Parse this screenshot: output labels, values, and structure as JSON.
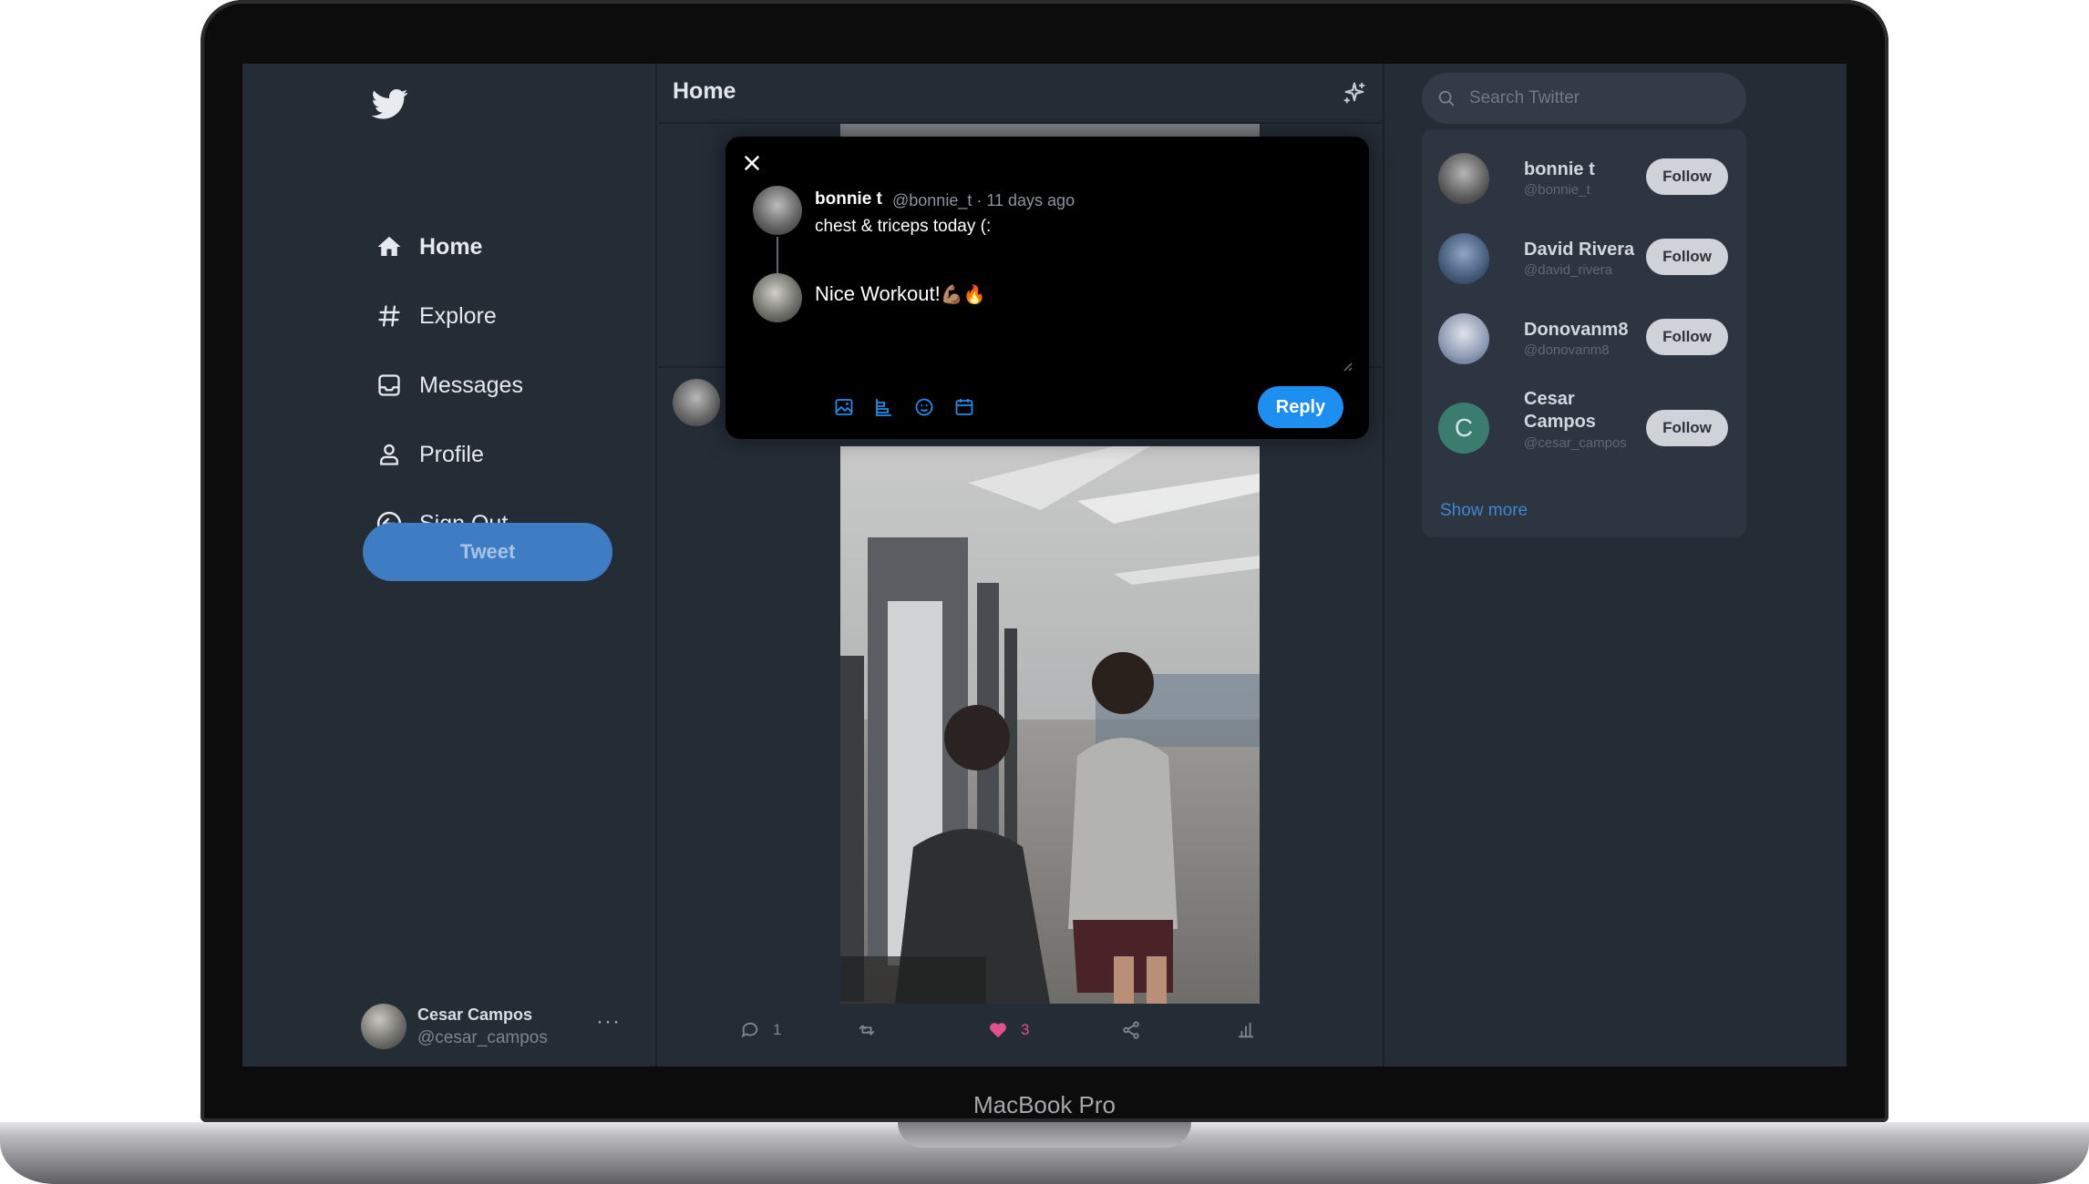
{
  "device": {
    "label": "MacBook Pro"
  },
  "sidebar": {
    "logo_icon": "twitter-bird-icon",
    "items": [
      {
        "label": "Home",
        "icon": "home-icon",
        "active": true
      },
      {
        "label": "Explore",
        "icon": "hashtag-icon",
        "active": false
      },
      {
        "label": "Messages",
        "icon": "inbox-icon",
        "active": false
      },
      {
        "label": "Profile",
        "icon": "user-icon",
        "active": false
      },
      {
        "label": "Sign Out",
        "icon": "sign-out-icon",
        "active": false
      }
    ],
    "tweet_label": "Tweet",
    "account": {
      "name": "Cesar Campos",
      "handle": "@cesar_campos",
      "more": "···"
    }
  },
  "feed": {
    "title": "Home",
    "post": {
      "actions": [
        {
          "name": "reply",
          "icon": "comment-icon",
          "count": "1"
        },
        {
          "name": "retweet",
          "icon": "retweet-icon",
          "count": ""
        },
        {
          "name": "like",
          "icon": "heart-icon",
          "count": "3",
          "liked": true
        },
        {
          "name": "share",
          "icon": "share-icon",
          "count": ""
        },
        {
          "name": "stats",
          "icon": "bar-chart-icon",
          "count": ""
        }
      ]
    }
  },
  "modal": {
    "original": {
      "name": "bonnie t",
      "meta": "@bonnie_t · 11 days ago",
      "text": "chest & triceps today (:"
    },
    "reply_text": "Nice Workout!",
    "reply_emoji": "💪🏽🔥",
    "reply_button": "Reply",
    "tools": [
      "image-icon",
      "poll-icon",
      "emoji-icon",
      "schedule-icon"
    ]
  },
  "right": {
    "search_placeholder": "Search Twitter",
    "who_to_follow": [
      {
        "name": "bonnie t",
        "handle": "@bonnie_t",
        "button": "Follow"
      },
      {
        "name": "David Rivera",
        "handle": "@david_rivera",
        "button": "Follow"
      },
      {
        "name": "Donovanm8",
        "handle": "@donovanm8",
        "button": "Follow"
      },
      {
        "name": "Cesar Campos",
        "handle": "@cesar_campos",
        "button": "Follow",
        "initial": "C"
      }
    ],
    "show_more": "Show more"
  },
  "colors": {
    "background": "#242c36",
    "accent": "#1d8ff0",
    "tweet_button": "#3e7cc4",
    "like": "#e0518d"
  }
}
